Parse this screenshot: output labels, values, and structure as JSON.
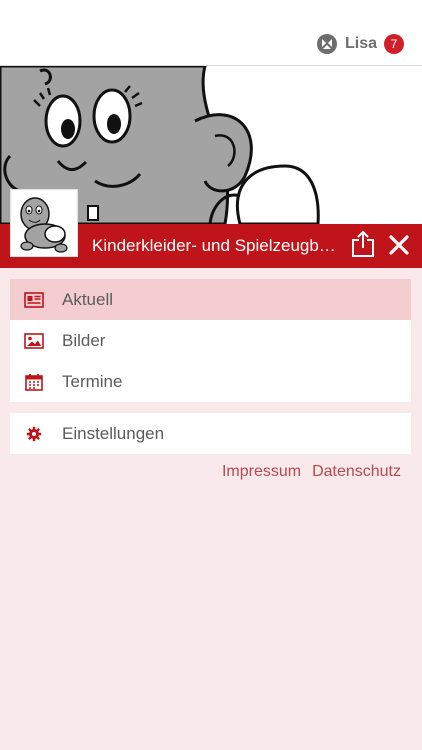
{
  "topbar": {
    "app_icon": "app-logo-icon",
    "user_name": "Lisa",
    "notification_count": "7"
  },
  "header": {
    "club_title": "Kinderkleider- und Spielzeugb…",
    "share_icon": "share-icon",
    "close_icon": "close-icon",
    "accent_color": "#c0141b"
  },
  "menu": {
    "items": [
      {
        "label": "Aktuell",
        "icon": "newspaper-icon",
        "active": true
      },
      {
        "label": "Bilder",
        "icon": "image-icon",
        "active": false
      },
      {
        "label": "Termine",
        "icon": "calendar-icon",
        "active": false
      }
    ],
    "settings": {
      "label": "Einstellungen",
      "icon": "gear-icon"
    }
  },
  "footer": {
    "impressum": "Impressum",
    "datenschutz": "Datenschutz"
  }
}
